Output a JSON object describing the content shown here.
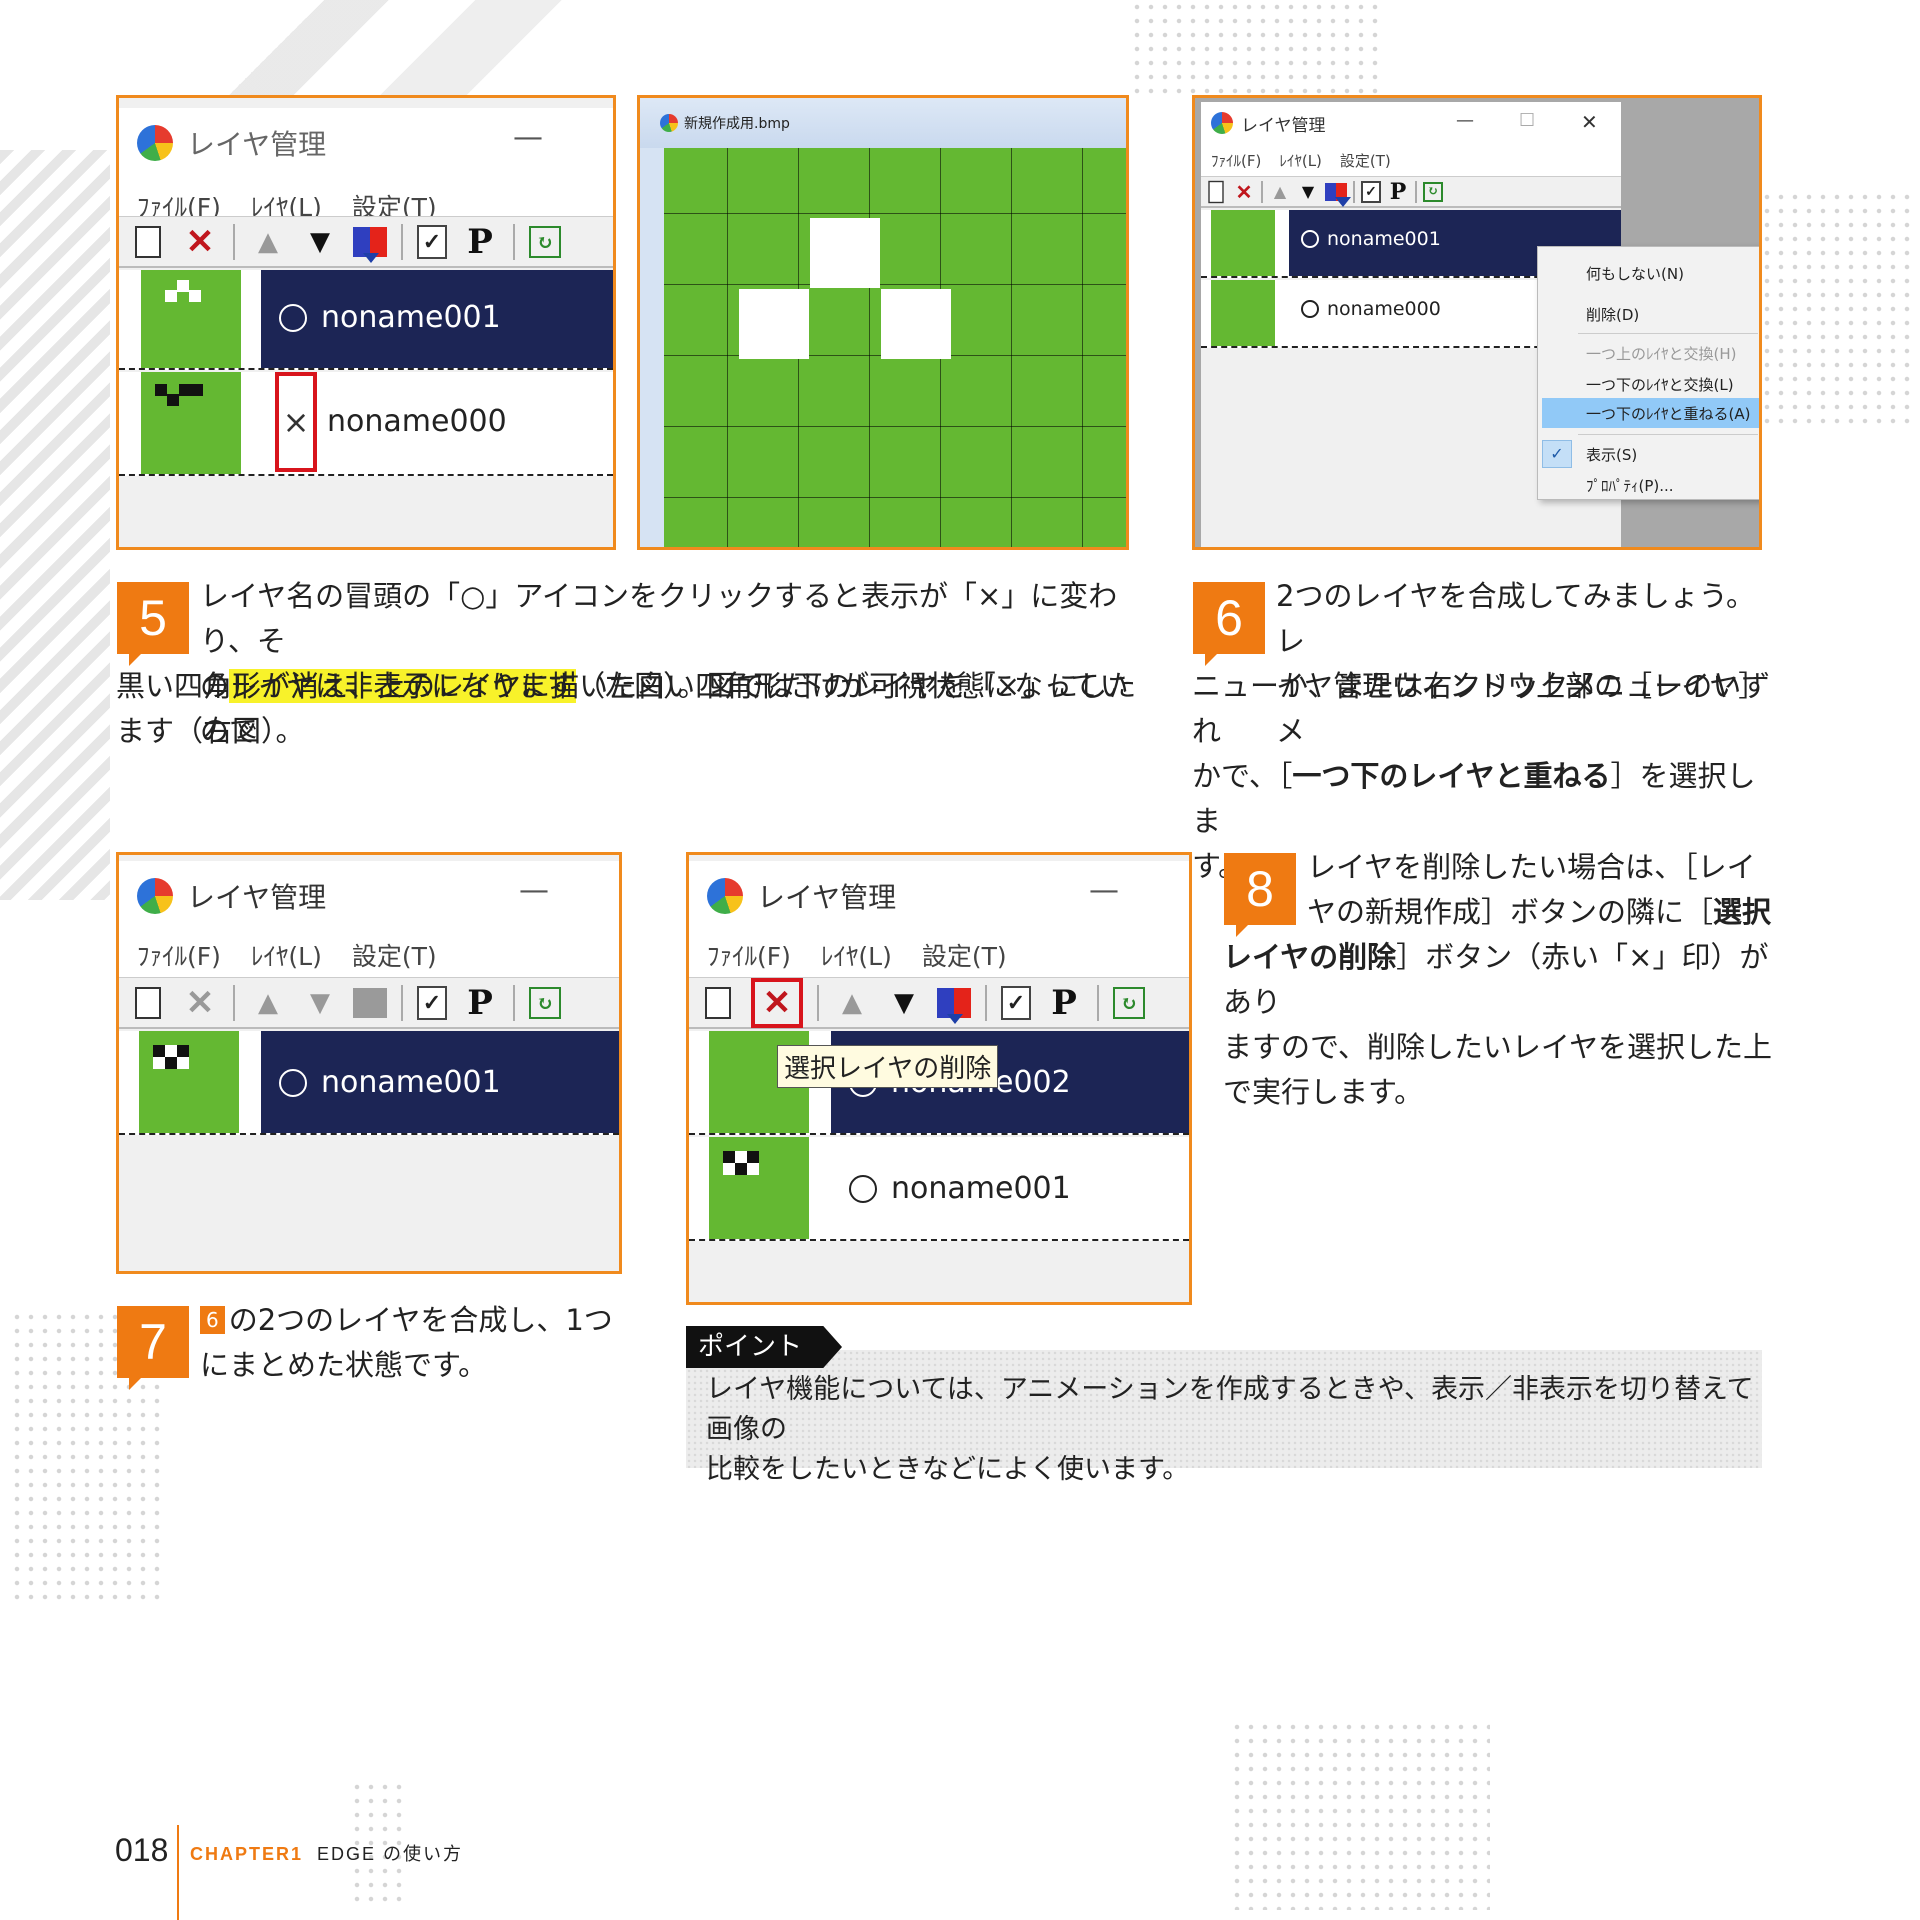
{
  "common": {
    "window_title": "レイヤ管理",
    "menu_file": "ﾌｧｲﾙ(F)",
    "menu_layer": "ﾚｲﾔ(L)",
    "menu_settings": "設定(T)",
    "min_symbol": "—",
    "circle_icon": "circle-visible-icon",
    "cross_icon": "cross-hidden-icon"
  },
  "shot1": {
    "layer_top": "noname001",
    "layer_bottom": "noname000",
    "hidden_mark": "×"
  },
  "shot2": {
    "title": "新規作成用.bmp"
  },
  "shot3": {
    "layer_top": "noname001",
    "layer_bottom": "noname000",
    "close_symbol": "✕",
    "max_symbol": "☐",
    "context_menu": [
      {
        "label": "何もしない(N)"
      },
      {
        "label": "削除(D)"
      },
      {
        "label": "一つ上のﾚｲﾔと交換(H)"
      },
      {
        "label": "一つ下のﾚｲﾔと交換(L)"
      },
      {
        "label": "一つ下のﾚｲﾔと重ねる(A)"
      },
      {
        "label": "表示(S)"
      },
      {
        "label": "ﾌﾟﾛﾊﾟﾃｨ(P)..."
      }
    ]
  },
  "step5": {
    "num": "5",
    "line1": "レイヤ名の冒頭の「○」アイコンをクリックすると表示が「×」に変わり、そ",
    "line2_pre": "の",
    "line2_hl": "レイヤは非表示になります",
    "line2_post": "（左図）。図では下のレイヤを「×」にしたので",
    "line3": "黒い四角形が消え、上のレイヤに描いた白い四角形だけが可視状態になってい",
    "line4": "ます（右図）。"
  },
  "step6": {
    "num": "6",
    "line1": "2つのレイヤを合成してみましょう。レ",
    "line2": "イヤ管理ウィンドウ上部の［レイヤ］メ",
    "line3": "ニューか、または右クリックメニューのいずれ",
    "line4_pre": "かで、［",
    "line4_b": "一つ下のレイヤと重ねる",
    "line4_post": "］を選択しま",
    "line5": "す。"
  },
  "shot4": {
    "layer_top": "noname001"
  },
  "shot5": {
    "layer_top": "noname002",
    "layer_bottom": "noname001",
    "tooltip": "選択レイヤの削除"
  },
  "step7": {
    "num": "7",
    "ref": "6",
    "line1": "の2つのレイヤを合成し、1つ",
    "line2": "にまとめた状態です。"
  },
  "step8": {
    "num": "8",
    "line1": "レイヤを削除したい場合は、［レイ",
    "line2_pre": "ヤの新規作成］ボタンの隣に［",
    "line2_b": "選択",
    "line3_b": "レイヤの削除",
    "line3_post": "］ボタン（赤い「×」印）があり",
    "line4": "ますので、削除したいレイヤを選択した上",
    "line5": "で実行します。"
  },
  "point": {
    "label": "ポイント",
    "line1": "レイヤ機能については、アニメーションを作成するときや、表示／非表示を切り替えて画像の",
    "line2": "比較をしたいときなどによく使います。"
  },
  "footer": {
    "page": "018",
    "chapter": "CHAPTER1",
    "title": "EDGE の使い方"
  },
  "colors": {
    "accent": "#ef7a12",
    "layer_selected": "#1c2555",
    "layer_green": "#64b832",
    "highlight": "#f8f22a",
    "delete_red": "#c0161d"
  }
}
